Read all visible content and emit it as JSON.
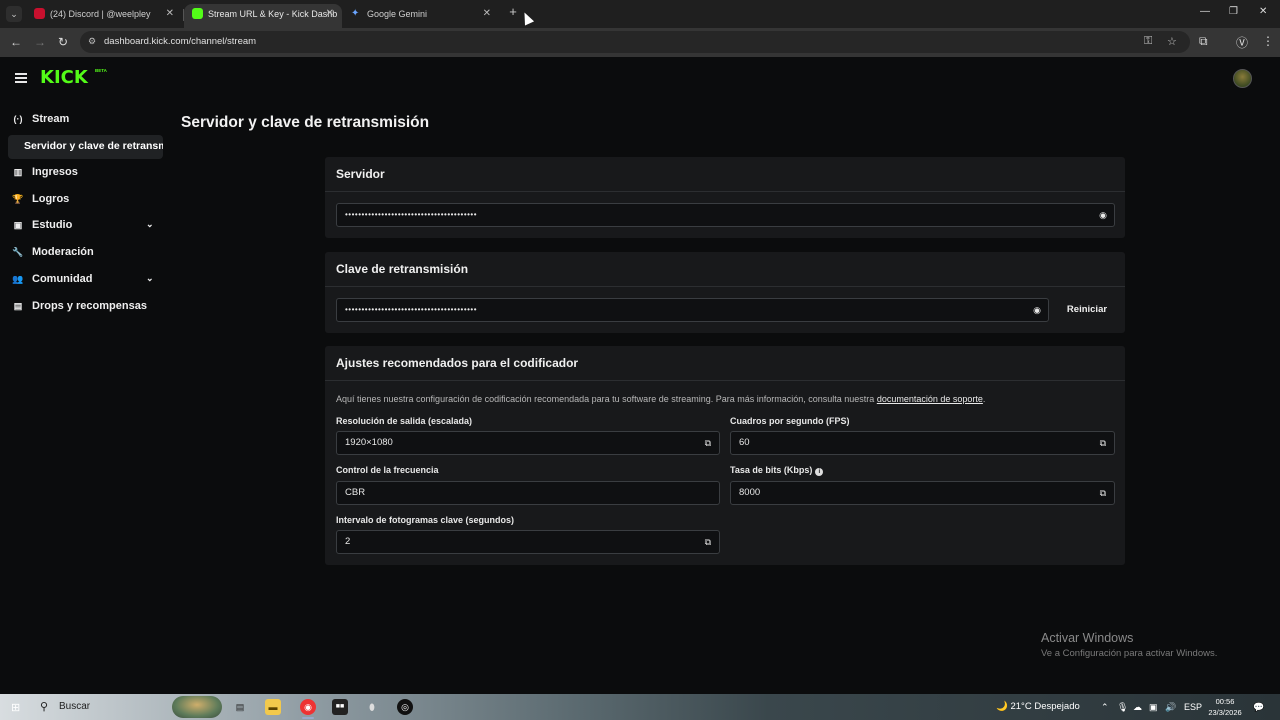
{
  "browser": {
    "tabs": [
      {
        "label": "(24) Discord | @weelpley",
        "favicon_color": "#c8102e"
      },
      {
        "label": "Stream URL & Key - Kick Dashb",
        "favicon_color": "#53fc18"
      },
      {
        "label": "Google Gemini",
        "favicon_color": "#6aa5ff"
      }
    ],
    "url": "dashboard.kick.com/channel/stream"
  },
  "app": {
    "logo": "KICK",
    "logo_badge": "BETA",
    "accent": "#53fc18"
  },
  "sidebar": {
    "items": [
      {
        "label": "Stream",
        "icon": "broadcast-icon",
        "glyph": "(·)"
      },
      {
        "label": "Ingresos",
        "icon": "chart-icon",
        "glyph": "▥"
      },
      {
        "label": "Logros",
        "icon": "trophy-icon",
        "glyph": "🏆"
      },
      {
        "label": "Estudio",
        "icon": "studio-icon",
        "glyph": "▣",
        "chevron": "⌄"
      },
      {
        "label": "Moderación",
        "icon": "wrench-icon",
        "glyph": "🔧"
      },
      {
        "label": "Comunidad",
        "icon": "people-icon",
        "glyph": "👥",
        "chevron": "⌄"
      },
      {
        "label": "Drops y recompensas",
        "icon": "gift-icon",
        "glyph": "▤"
      }
    ],
    "sub_item": "Servidor y clave de retransmisión"
  },
  "main": {
    "title": "Servidor y clave de retransmisión",
    "server": {
      "heading": "Servidor",
      "masked_value": "••••••••••••••••••••••••••••••••••••••••"
    },
    "stream_key": {
      "heading": "Clave de retransmisión",
      "masked_value": "••••••••••••••••••••••••••••••••••••••••",
      "reset_label": "Reiniciar"
    },
    "encoder": {
      "heading": "Ajustes recomendados para el codificador",
      "description": "Aquí tienes nuestra configuración de codificación recomendada para tu software de streaming. Para más información, consulta nuestra ",
      "link": "documentación de soporte",
      "description_end": ".",
      "fields": {
        "resolution": {
          "label": "Resolución de salida (escalada)",
          "value": "1920×1080"
        },
        "fps": {
          "label": "Cuadros por segundo (FPS)",
          "value": "60"
        },
        "rate_control": {
          "label": "Control de la frecuencia",
          "value": "CBR"
        },
        "bitrate": {
          "label": "Tasa de bits (Kbps)",
          "value": "8000"
        },
        "keyframe": {
          "label": "Intervalo de fotogramas clave (segundos)",
          "value": "2"
        }
      }
    }
  },
  "watermark": {
    "line1": "Activar Windows",
    "line2": "Ve a Configuración para activar Windows."
  },
  "taskbar": {
    "search": "Buscar",
    "weather": "21°C  Despejado",
    "language": "ESP",
    "time": "00:56",
    "date": "23/3/2026"
  }
}
